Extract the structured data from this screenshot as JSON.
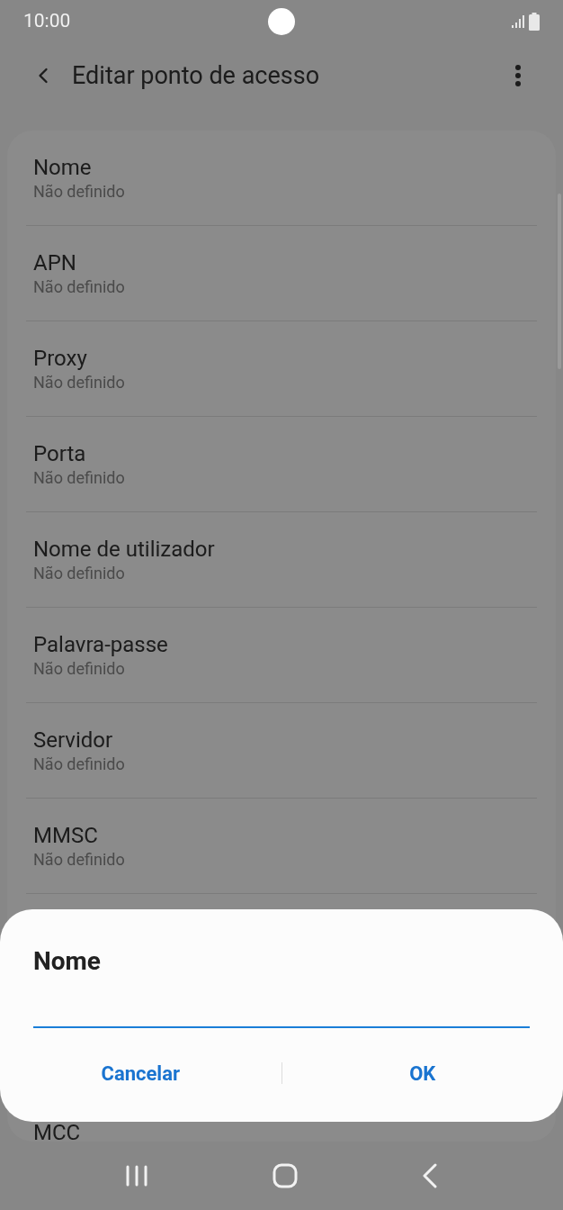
{
  "status_bar": {
    "time": "10:00"
  },
  "header": {
    "title": "Editar ponto de acesso"
  },
  "settings": [
    {
      "title": "Nome",
      "value": "Não definido"
    },
    {
      "title": "APN",
      "value": "Não definido"
    },
    {
      "title": "Proxy",
      "value": "Não definido"
    },
    {
      "title": "Porta",
      "value": "Não definido"
    },
    {
      "title": "Nome de utilizador",
      "value": "Não definido"
    },
    {
      "title": "Palavra-passe",
      "value": "Não definido"
    },
    {
      "title": "Servidor",
      "value": "Não definido"
    },
    {
      "title": "MMSC",
      "value": "Não definido"
    },
    {
      "title": "MCC"
    }
  ],
  "dialog": {
    "title": "Nome",
    "buttons": [
      "Cancelar",
      "OK"
    ]
  }
}
